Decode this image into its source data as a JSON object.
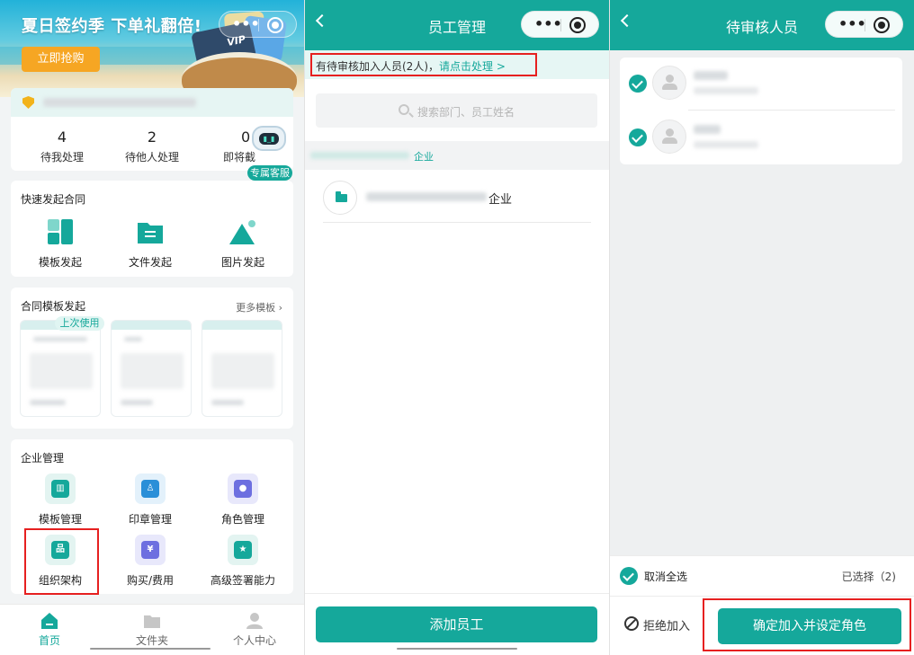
{
  "home": {
    "banner": {
      "title": "夏日签约季 下单礼翻倍!",
      "cta": "立即抢购",
      "card_text": "VIP"
    },
    "stats": [
      {
        "value": "4",
        "label": "待我处理"
      },
      {
        "value": "2",
        "label": "待他人处理"
      },
      {
        "value": "0",
        "label": "即将截"
      }
    ],
    "support_label": "专属客服",
    "quick_start": {
      "title": "快速发起合同",
      "items": [
        "模板发起",
        "文件发起",
        "图片发起"
      ]
    },
    "templates": {
      "title": "合同模板发起",
      "more": "更多模板 ›",
      "last_used_badge": "上次使用"
    },
    "enterprise": {
      "title": "企业管理",
      "items": [
        "模板管理",
        "印章管理",
        "角色管理",
        "组织架构",
        "购买/费用",
        "高级签署能力"
      ]
    },
    "tabbar": [
      "首页",
      "文件夹",
      "个人中心"
    ]
  },
  "staff": {
    "title": "员工管理",
    "notice_prefix": "有待审核加入人员(2人)，",
    "notice_link": "请点击处理 >",
    "search_placeholder": "搜索部门、员工姓名",
    "crumb": "企业",
    "org_suffix": "企业",
    "add_button": "添加员工"
  },
  "pending": {
    "title": "待审核人员",
    "cancel_all": "取消全选",
    "selected": "已选择（2)",
    "reject": "拒绝加入",
    "confirm": "确定加入并设定角色"
  },
  "colors": {
    "primary": "#15a89b",
    "highlight": "#e62020"
  }
}
